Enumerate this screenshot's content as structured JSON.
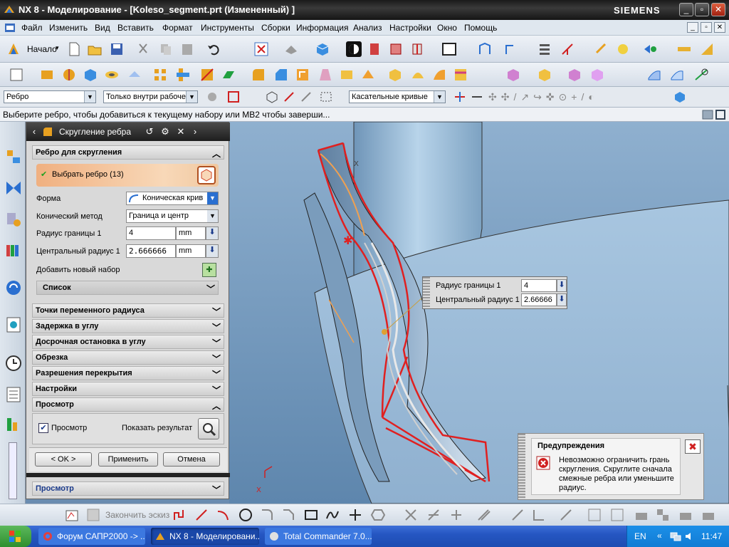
{
  "window": {
    "title": "NX 8 - Моделирование - [Koleso_segment.prt (Измененный) ]",
    "brand": "SIEMENS"
  },
  "menu": {
    "items": [
      "Файл",
      "Изменить",
      "Вид",
      "Вставить",
      "Формат",
      "Инструменты",
      "Сборки",
      "Информация",
      "Анализ",
      "Настройки",
      "Окно",
      "Помощь"
    ]
  },
  "toolbar": {
    "start_label": "Начало",
    "filter_type": "Ребро",
    "filter_scope": "Только внутри рабоче",
    "curve_rule": "Касательные кривые"
  },
  "status": {
    "prompt": "Выберите ребро, чтобы добавиться к текущему набору или MB2 чтобы заверши..."
  },
  "dialog": {
    "title": "Скругление ребра",
    "section_edge": "Ребро для скругления",
    "select_edge": "Выбрать ребро (13)",
    "shape_label": "Форма",
    "shape_value": "Коническая крив",
    "conic_method_label": "Конический метод",
    "conic_method_value": "Граница и центр",
    "boundary_radius_label": "Радиус границы 1",
    "boundary_radius_value": "4",
    "boundary_radius_unit": "mm",
    "center_radius_label": "Центральный радиус 1",
    "center_radius_value": "2.666666",
    "center_radius_unit": "mm",
    "add_set_label": "Добавить новый набор",
    "list_label": "Список",
    "sections": [
      "Точки переменного радиуса",
      "Задержка в углу",
      "Досрочная остановка в углу",
      "Обрезка",
      "Разрешения перекрытия",
      "Настройки",
      "Просмотр"
    ],
    "preview_checkbox": "Просмотр",
    "show_result": "Показать результат",
    "ok": "< OK >",
    "apply": "Применить",
    "cancel": "Отмена",
    "bottom_section": "Просмотр"
  },
  "onscreen_input": {
    "boundary_label": "Радиус границы 1",
    "boundary_value": "4",
    "center_label": "Центральный радиус 1",
    "center_value": "2.66666"
  },
  "warning": {
    "title": "Предупреждения",
    "message": "Невозможно ограничить грань скругления. Скруглите сначала смежные ребра или уменьшите радиус."
  },
  "sketchbar": {
    "finish_sketch": "Закончить эскиз"
  },
  "taskbar": {
    "tasks": [
      "Форум САПР2000 -> ...",
      "NX 8 - Моделировани...",
      "Total Commander 7.0..."
    ],
    "lang": "EN",
    "clock": "11:47"
  },
  "colors": {
    "accent_red": "#e02020",
    "model_blue": "#8fb8d8",
    "select_orange": "#f0a050"
  }
}
